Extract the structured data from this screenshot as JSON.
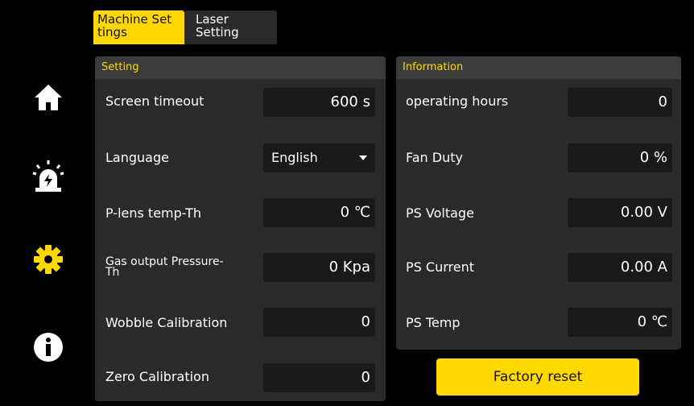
{
  "sidebar": {
    "items": [
      {
        "icon": "home-icon"
      },
      {
        "icon": "alarm-icon"
      },
      {
        "icon": "gear-icon",
        "active": true
      },
      {
        "icon": "info-icon"
      }
    ],
    "active_color": "#ffd800"
  },
  "tabs": [
    {
      "label_line1": "Machine Set",
      "label_line2": "tings",
      "active": true
    },
    {
      "label_line1": "Laser",
      "label_line2": "Setting",
      "active": false
    }
  ],
  "setting_panel": {
    "title": "Setting",
    "rows": [
      {
        "label": "Screen timeout",
        "value": "600 s"
      },
      {
        "label": "Language",
        "value": "English"
      },
      {
        "label": "P-lens temp-Th",
        "value": "0 ℃"
      },
      {
        "label_line1": "Gas output Pressure-",
        "label_line2": "Th",
        "value": "0 Kpa"
      },
      {
        "label": "Wobble Calibration",
        "value": "0"
      },
      {
        "label": "Zero Calibration",
        "value": "0"
      }
    ]
  },
  "info_panel": {
    "title": "Information",
    "rows": [
      {
        "label": "operating hours",
        "value": "0"
      },
      {
        "label": "Fan Duty",
        "value": "0 %"
      },
      {
        "label": "PS Voltage",
        "value": "0.00 V"
      },
      {
        "label": "PS Current",
        "value": "0.00 A"
      },
      {
        "label": "PS Temp",
        "value": "0 ℃"
      }
    ]
  },
  "factory_reset": {
    "label": "Factory reset"
  },
  "colors": {
    "accent": "#ffd800",
    "panel": "#2a2a2a",
    "field": "#191919"
  }
}
